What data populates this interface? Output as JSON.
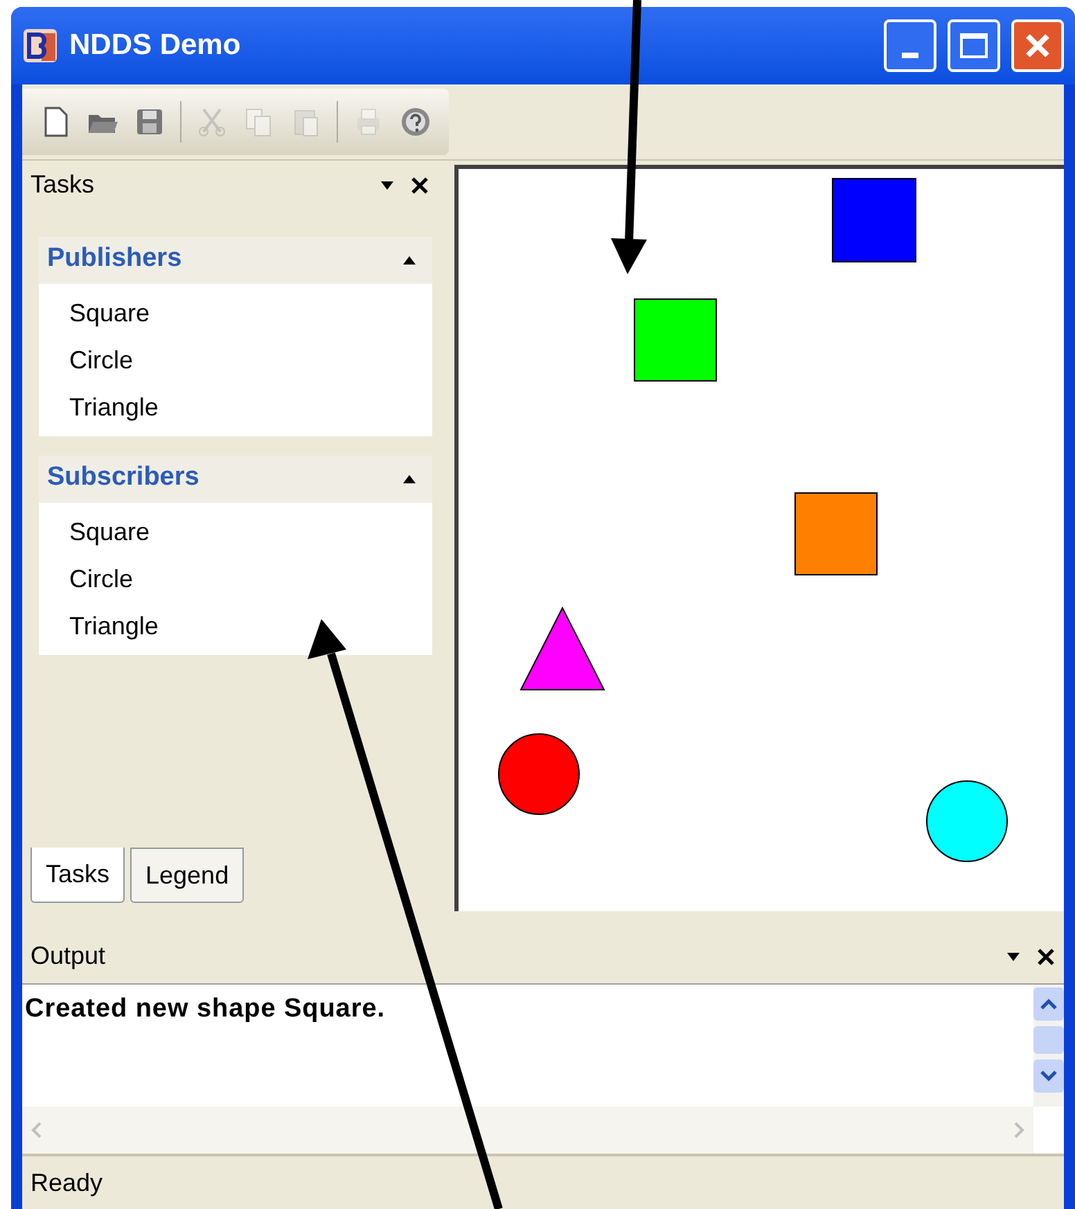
{
  "window": {
    "title": "NDDS Demo"
  },
  "toolbar": [
    {
      "kind": "new",
      "disabled": false
    },
    {
      "kind": "open",
      "disabled": false
    },
    {
      "kind": "save",
      "disabled": false
    },
    {
      "kind": "separator"
    },
    {
      "kind": "cut",
      "disabled": true
    },
    {
      "kind": "copy",
      "disabled": true
    },
    {
      "kind": "paste",
      "disabled": true
    },
    {
      "kind": "separator"
    },
    {
      "kind": "print",
      "disabled": true
    },
    {
      "kind": "help",
      "disabled": false
    }
  ],
  "tasks_panel": {
    "title": "Tasks",
    "groups": [
      {
        "title": "Publishers",
        "expanded": true,
        "items": [
          "Square",
          "Circle",
          "Triangle"
        ]
      },
      {
        "title": "Subscribers",
        "expanded": true,
        "items": [
          "Square",
          "Circle",
          "Triangle"
        ]
      }
    ],
    "tabs": [
      {
        "label": "Tasks",
        "selected": true
      },
      {
        "label": "Legend",
        "selected": false
      }
    ]
  },
  "canvas": {
    "shapes": [
      {
        "kind": "square",
        "color": "#0000ff"
      },
      {
        "kind": "square",
        "color": "#00ff00"
      },
      {
        "kind": "square",
        "color": "#ff8000"
      },
      {
        "kind": "triangle",
        "color": "#ff00ff"
      },
      {
        "kind": "circle",
        "color": "#ff0000"
      },
      {
        "kind": "circle",
        "color": "#00ffff"
      }
    ]
  },
  "output": {
    "title": "Output",
    "text": "Created new shape Square."
  },
  "status_bar": {
    "text": "Ready"
  }
}
